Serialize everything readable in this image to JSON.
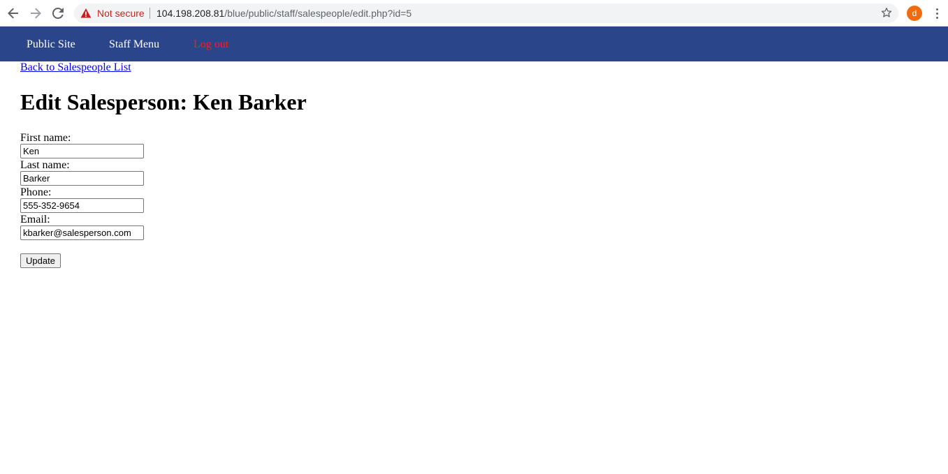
{
  "browser": {
    "security_label": "Not secure",
    "url_host": "104.198.208.81",
    "url_path": "/blue/public/staff/salespeople/edit.php?id=5",
    "profile_initial": "d",
    "icons": [
      "back-arrow-icon",
      "forward-arrow-icon",
      "reload-icon",
      "warning-icon",
      "star-icon",
      "more-vert-icon"
    ]
  },
  "nav": {
    "public_site": "Public Site",
    "staff_menu": "Staff Menu",
    "logout": "Log out"
  },
  "page": {
    "back_link": "Back to Salespeople List",
    "title": "Edit Salesperson: Ken Barker"
  },
  "form": {
    "first_name_label": "First name:",
    "first_name_value": "Ken",
    "last_name_label": "Last name:",
    "last_name_value": "Barker",
    "phone_label": "Phone:",
    "phone_value": "555-352-9654",
    "email_label": "Email:",
    "email_value": "kbarker@salesperson.com",
    "submit_label": "Update"
  },
  "colors": {
    "nav_background": "#2a4589",
    "logout_color": "#ff1a1a",
    "link_color": "#0000ee",
    "avatar_color": "#f06a10",
    "warning_color": "#c5221f"
  }
}
